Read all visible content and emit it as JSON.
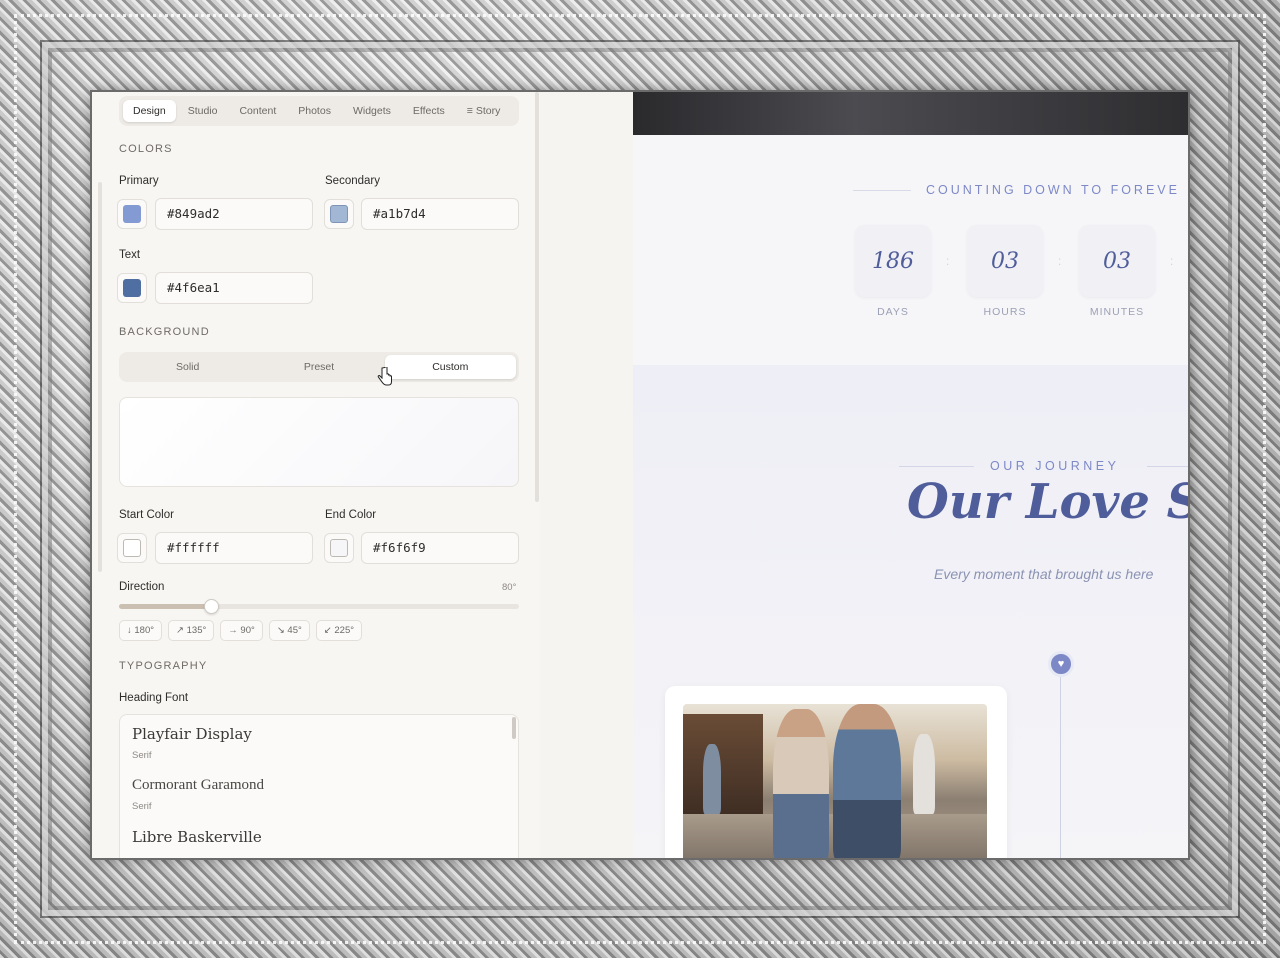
{
  "editor": {
    "tabs": [
      {
        "label": "Design",
        "active": true
      },
      {
        "label": "Studio"
      },
      {
        "label": "Content"
      },
      {
        "label": "Photos"
      },
      {
        "label": "Widgets"
      },
      {
        "label": "Effects"
      },
      {
        "label": "≡ Story"
      }
    ],
    "colors": {
      "title": "COLORS",
      "primary_label": "Primary",
      "primary_value": "#849ad2",
      "secondary_label": "Secondary",
      "secondary_value": "#a1b7d4",
      "text_label": "Text",
      "text_value": "#4f6ea1"
    },
    "background": {
      "title": "BACKGROUND",
      "modes": [
        "Solid",
        "Preset",
        "Custom"
      ],
      "active_mode": "Custom",
      "start_label": "Start Color",
      "start_value": "#ffffff",
      "end_label": "End Color",
      "end_value": "#f6f6f9",
      "direction_label": "Direction",
      "direction_value": "80°",
      "direction_fraction": 0.23,
      "presets": [
        "↓ 180°",
        "↗ 135°",
        "→ 90°",
        "↘ 45°",
        "↙ 225°"
      ]
    },
    "typography": {
      "title": "TYPOGRAPHY",
      "heading_label": "Heading Font",
      "fonts": [
        {
          "name": "Playfair Display",
          "category": "Serif"
        },
        {
          "name": "Cormorant Garamond",
          "category": "Serif"
        },
        {
          "name": "Libre Baskerville",
          "category": ""
        }
      ]
    }
  },
  "site": {
    "countdown": {
      "heading": "COUNTING DOWN TO FOREVE",
      "items": [
        {
          "value": "186",
          "label": "DAYS"
        },
        {
          "value": "03",
          "label": "HOURS"
        },
        {
          "value": "03",
          "label": "MINUTES"
        }
      ]
    },
    "story": {
      "kicker": "OUR JOURNEY",
      "title": "Our Love Sto",
      "subtitle": "Every moment that brought us here"
    }
  },
  "colors": {
    "primary": "#849ad2",
    "secondary": "#a1b7d4",
    "text": "#4f6ea1",
    "accent": "#7d89c7"
  }
}
